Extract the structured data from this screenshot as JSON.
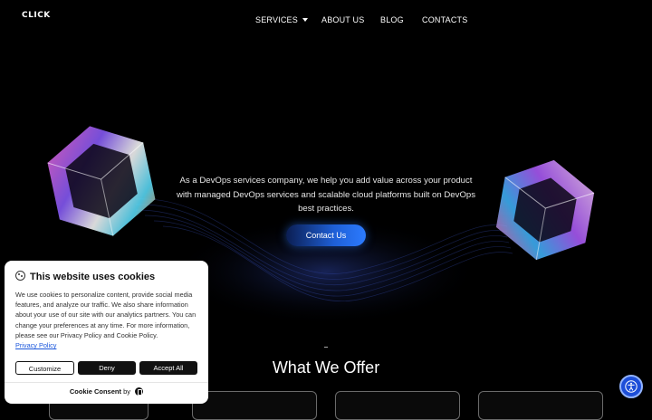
{
  "header": {
    "logo_text": "CLICK",
    "nav": [
      {
        "label": "SERVICES",
        "has_dropdown": true
      },
      {
        "label": "ABOUT US"
      },
      {
        "label": "BLOG"
      },
      {
        "label": "CONTACTS"
      }
    ]
  },
  "hero": {
    "description": "As a DevOps services company, we help you add value across your product with managed DevOps services and scalable cloud platforms built on DevOps best practices.",
    "cta_label": "Contact Us"
  },
  "offer": {
    "title": "What We Offer"
  },
  "cookie_banner": {
    "title": "This website uses cookies",
    "body": "We use cookies to personalize content, provide social media features, and analyze our traffic. We also share information about your use of our site with our analytics partners. You can change your preferences at any time. For more information, please see our Privacy Policy and Cookie Policy.",
    "privacy_link": "Privacy Policy",
    "buttons": {
      "customize": "Customize",
      "deny": "Deny",
      "accept": "Accept All"
    },
    "footer_prefix": "Cookie Consent",
    "footer_by": "by"
  },
  "icons": {
    "accessibility": "accessibility-icon",
    "cookie": "cookie-icon",
    "caret": "chevron-down-icon"
  },
  "colors": {
    "background": "#000000",
    "cta_gradient_start": "#0b1e52",
    "cta_gradient_end": "#2c7bff",
    "accessibility_button": "#1d4ed8"
  }
}
